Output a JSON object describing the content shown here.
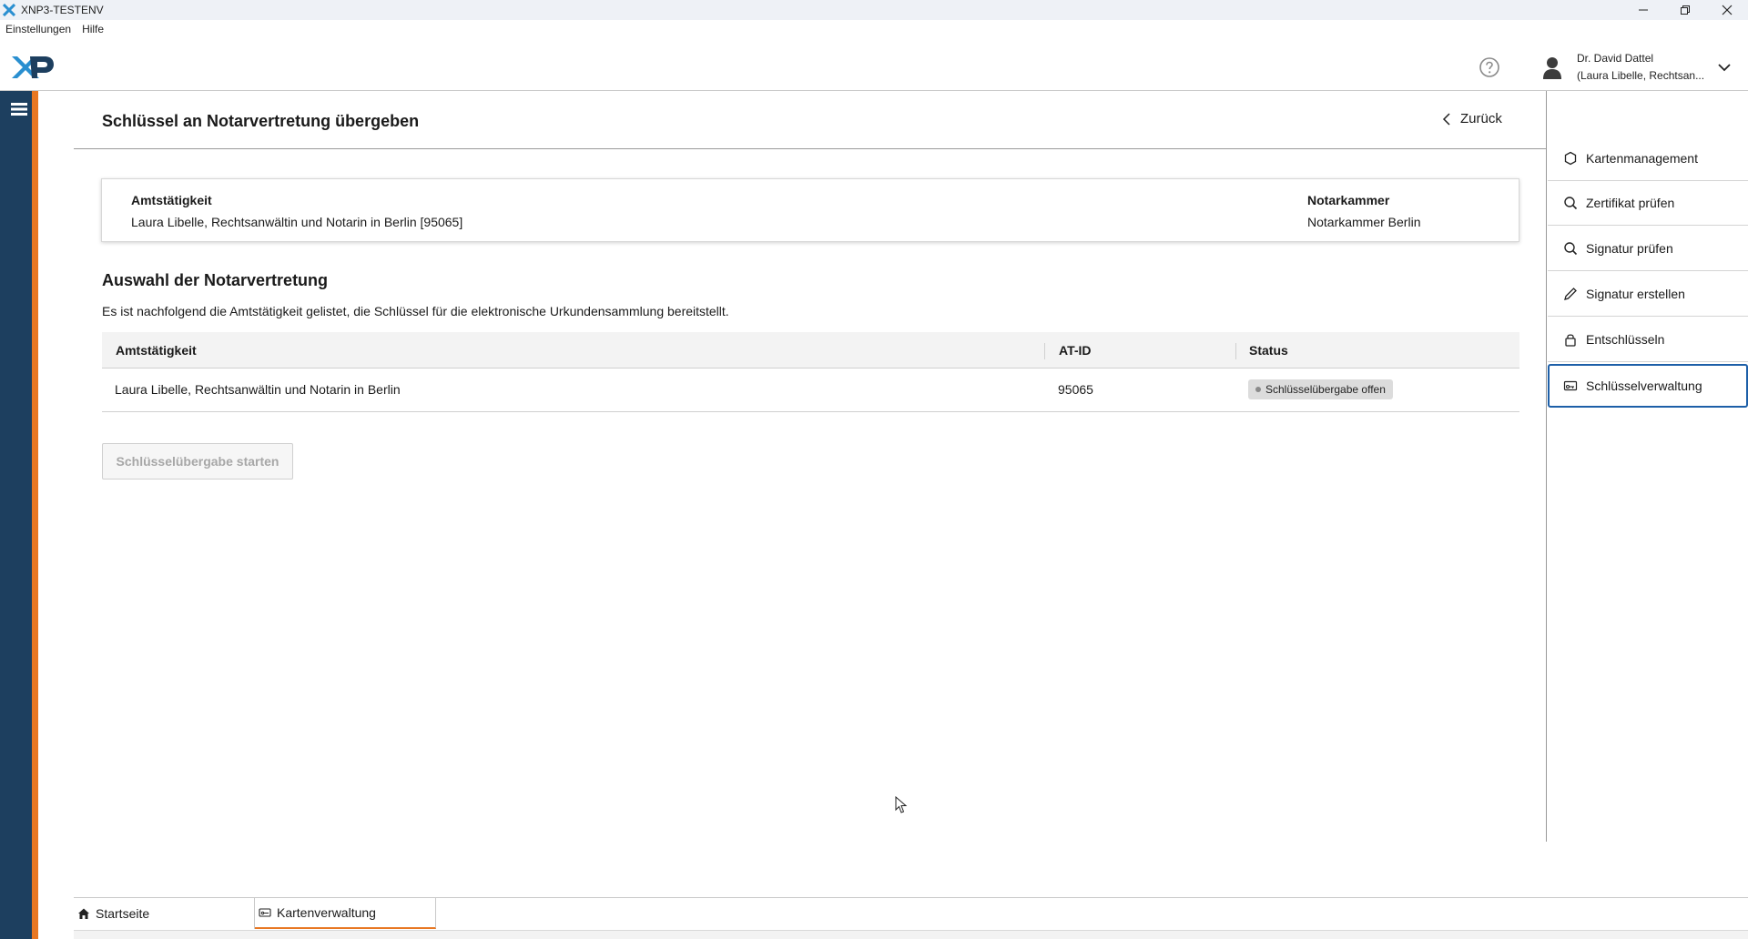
{
  "window": {
    "title": "XNP3-TESTENV",
    "controls": [
      "minimize-icon",
      "restore-icon",
      "close-icon"
    ]
  },
  "menu": {
    "items": [
      "Einstellungen",
      "Hilfe"
    ]
  },
  "header": {
    "logo_text": "XP",
    "user_name": "Dr. David Dattel",
    "user_office": "(Laura Libelle, Rechtsan..."
  },
  "page": {
    "title": "Schlüssel an Notarvertretung übergeben",
    "back_label": "Zurück"
  },
  "info": {
    "amt_label": "Amtstätigkeit",
    "amt_value": "Laura Libelle, Rechtsanwältin und Notarin in Berlin [95065]",
    "kammer_label": "Notarkammer",
    "kammer_value": "Notarkammer Berlin"
  },
  "section": {
    "title": "Auswahl der Notarvertretung",
    "description": "Es ist nachfolgend die Amtstätigkeit gelistet, die Schlüssel für die elektronische Urkundensammlung bereitstellt."
  },
  "table": {
    "columns": [
      "Amtstätigkeit",
      "AT-ID",
      "Status"
    ],
    "rows": [
      {
        "amtstaetigkeit": "Laura Libelle, Rechtsanwältin und Notarin in Berlin",
        "at_id": "95065",
        "status": "Schlüsselübergabe offen"
      }
    ]
  },
  "actions": {
    "start_label": "Schlüsselübergabe starten"
  },
  "sidebar": {
    "items": [
      {
        "label": "Kartenmanagement",
        "icon": "circle-icon"
      },
      {
        "label": "Zertifikat prüfen",
        "icon": "search-icon"
      },
      {
        "label": "Signatur prüfen",
        "icon": "search-icon"
      },
      {
        "label": "Signatur erstellen",
        "icon": "pen-icon"
      },
      {
        "label": "Entschlüsseln",
        "icon": "lock-icon"
      },
      {
        "label": "Schlüsselverwaltung",
        "icon": "key-card-icon",
        "active": true
      }
    ]
  },
  "tabs": [
    {
      "label": "Startseite",
      "icon": "home-icon"
    },
    {
      "label": "Kartenverwaltung",
      "icon": "card-icon",
      "active": true
    }
  ],
  "colors": {
    "nav_bg": "#1d3f5f",
    "accent_orange": "#e87722",
    "active_border": "#1d5fa8",
    "logo_blue": "#2a8fd0",
    "logo_dark": "#1d3f5f"
  }
}
